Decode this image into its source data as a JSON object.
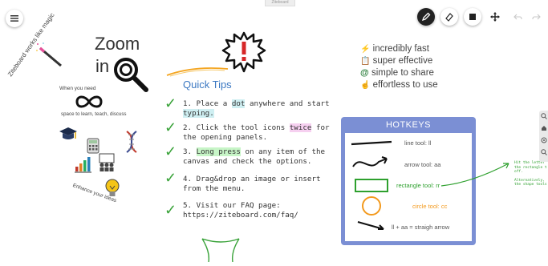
{
  "window": {
    "tab_label": "Ziteboard"
  },
  "menu": {
    "icon": "hamburger-icon"
  },
  "toolbar": {
    "tools": [
      {
        "name": "pencil-tool",
        "icon": "pencil-icon",
        "active": true
      },
      {
        "name": "eraser-tool",
        "icon": "eraser-icon",
        "active": false
      },
      {
        "name": "shape-tool",
        "icon": "square-icon",
        "active": false
      },
      {
        "name": "move-tool",
        "icon": "move-icon",
        "active": false
      }
    ],
    "undo_icon": "undo-icon",
    "redo_icon": "redo-icon"
  },
  "canvas": {
    "intro": {
      "magic_text": "Ziteboard works like magic",
      "zoom_word": "Zoom",
      "in_word": "in",
      "when_you_need": "When you need",
      "space_text": "space to learn, teach, discuss",
      "enhance_text": "Enhance your ideas"
    },
    "quick_tips": {
      "title": "Quick Tips",
      "tips": [
        {
          "parts": [
            "1. Place a ",
            "dot",
            " anywhere and start"
          ],
          "line2_parts": [
            "",
            "typing."
          ]
        },
        {
          "parts": [
            "2. Click the tool icons ",
            "twice",
            " for"
          ],
          "line2": "the opening panels."
        },
        {
          "parts": [
            "3. ",
            "Long press",
            " on any item of the"
          ],
          "line2": "canvas and check the options."
        },
        {
          "line1": "4. Drag&drop an image or insert",
          "line2": "from the menu."
        },
        {
          "line1": "5. Visit our FAQ page:",
          "line2": "https://ziteboard.com/faq/"
        }
      ]
    },
    "features": [
      {
        "icon": "lightning-icon",
        "text": "incredibly fast"
      },
      {
        "icon": "clipboard-icon",
        "text": "super effective"
      },
      {
        "icon": "at-icon",
        "text": "simple to share"
      },
      {
        "icon": "pointer-hand-icon",
        "text": "effortless to use"
      }
    ],
    "hotkeys": {
      "title": "HOTKEYS",
      "items": [
        {
          "label": "line tool: ll",
          "color": "#555555"
        },
        {
          "label": "arrow tool: aa",
          "color": "#555555"
        },
        {
          "label": "rectangle tool: rr",
          "color": "#2ea02e"
        },
        {
          "label": "circle tool: cc",
          "color": "#f39a1e"
        },
        {
          "label": "ll + aa = straigh arrow",
          "color": "#555555"
        }
      ]
    },
    "side_note": {
      "lines": [
        "Hit the letter",
        "the rectangle t",
        "off.",
        "",
        "Alternatively,",
        "the shape tools"
      ]
    }
  },
  "zoom_panel": {
    "icons": [
      "zoom-in-icon",
      "home-icon",
      "reset-icon",
      "zoom-out-icon"
    ]
  },
  "colors": {
    "accent_blue": "#7b8fd4",
    "check_green": "#3aa33a",
    "tips_title": "#3b78c2",
    "rect_green": "#2ea02e",
    "circle_orange": "#f39a1e"
  }
}
